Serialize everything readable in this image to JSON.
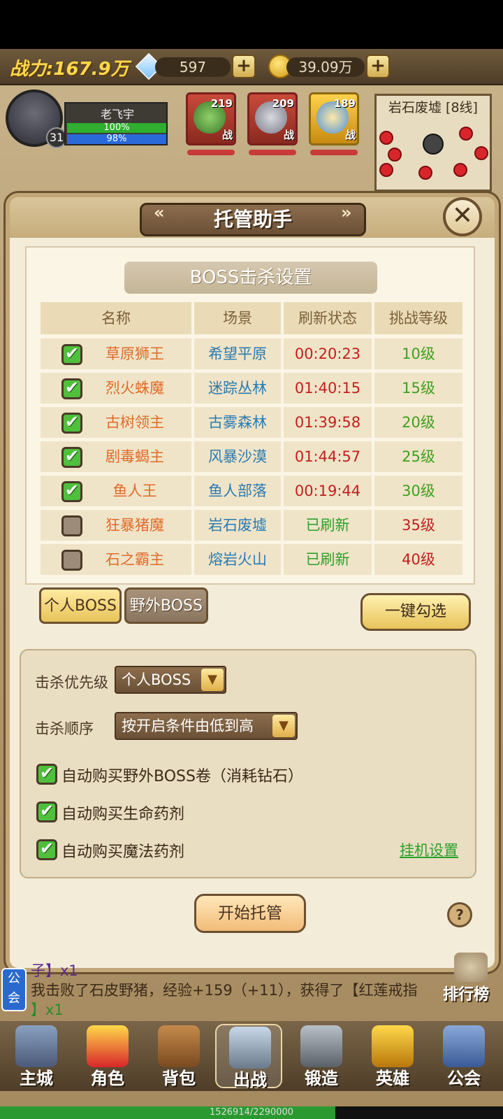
{
  "topbar": {
    "power": "战力:167.9万",
    "diamonds": "597",
    "gold": "39.09万"
  },
  "player": {
    "name": "老飞宇",
    "level": "31",
    "hp": "100%",
    "mp": "98%"
  },
  "heroes": [
    {
      "level": "219",
      "tag": "战"
    },
    {
      "level": "209",
      "tag": "战"
    },
    {
      "level": "189",
      "tag": "战"
    }
  ],
  "minimap": {
    "title": "岩石废墟 [8线]"
  },
  "panel": {
    "title": "托管助手",
    "left_arrow": "«",
    "right_arrow": "»",
    "close": "✕",
    "section_title": "BOSS击杀设置",
    "columns": [
      "名称",
      "场景",
      "刷新状态",
      "挑战等级"
    ],
    "rows": [
      {
        "checked": true,
        "name": "草原狮王",
        "scene": "希望平原",
        "status": "00:20:23",
        "level": "10级"
      },
      {
        "checked": true,
        "name": "烈火蛛魔",
        "scene": "迷踪丛林",
        "status": "01:40:15",
        "level": "15级"
      },
      {
        "checked": true,
        "name": "古树领主",
        "scene": "古雾森林",
        "status": "01:39:58",
        "level": "20级"
      },
      {
        "checked": true,
        "name": "剧毒蝎主",
        "scene": "风暴沙漠",
        "status": "01:44:57",
        "level": "25级"
      },
      {
        "checked": true,
        "name": "鱼人王",
        "scene": "鱼人部落",
        "status": "00:19:44",
        "level": "30级"
      },
      {
        "checked": false,
        "name": "狂暴猪魔",
        "scene": "岩石废墟",
        "status": "已刷新",
        "level": "35级"
      },
      {
        "checked": false,
        "name": "石之霸主",
        "scene": "熔岩火山",
        "status": "已刷新",
        "level": "40级"
      }
    ],
    "tabs": {
      "personal": "个人BOSS",
      "wild": "野外BOSS"
    },
    "select_all": "一键勾选",
    "priority_label": "击杀优先级",
    "priority_value": "个人BOSS",
    "order_label": "击杀顺序",
    "order_value": "按开启条件由低到高",
    "options": [
      "自动购买野外BOSS卷（消耗钻石）",
      "自动购买生命药剂",
      "自动购买魔法药剂"
    ],
    "idle_link": "挂机设置",
    "start": "开始托管",
    "help": "?"
  },
  "chat": {
    "line1": "子】x1",
    "line2": "我击败了石皮野猪，经验+159（+11），获得了【红莲戒指",
    "line3": "】x1",
    "guild_tag": "公会"
  },
  "rank_label": "排行榜",
  "nav": [
    "主城",
    "角色",
    "背包",
    "出战",
    "锻造",
    "英雄",
    "公会"
  ],
  "xp": {
    "text": "1526914/2290000",
    "fraction": 0.667
  }
}
